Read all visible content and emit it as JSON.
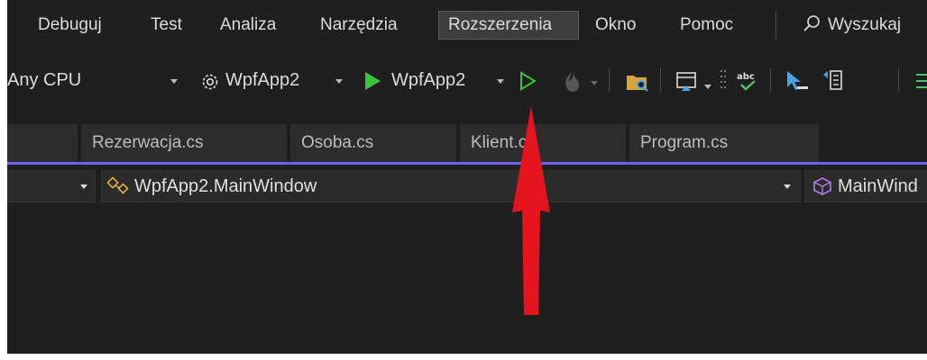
{
  "menu": {
    "items": [
      {
        "label": "Debuguj"
      },
      {
        "label": "Test"
      },
      {
        "label": "Analiza"
      },
      {
        "label": "Narzędzia"
      },
      {
        "label": "Rozszerzenia",
        "active": true
      },
      {
        "label": "Okno"
      },
      {
        "label": "Pomoc"
      }
    ],
    "search_label": "Wyszukaj"
  },
  "toolbar": {
    "platform_value": "Any CPU",
    "startup_project": "WpfApp2",
    "run_target": "WpfApp2",
    "icons": [
      "gear-icon",
      "start-debugging-icon",
      "start-without-debugging-icon",
      "hot-reload-icon",
      "solution-explorer-icon",
      "window-layout-icon",
      "spell-check-icon",
      "pointer-icon",
      "document-outline-icon"
    ]
  },
  "tabs": [
    {
      "label": ""
    },
    {
      "label": "Rezerwacja.cs"
    },
    {
      "label": "Osoba.cs"
    },
    {
      "label": "Klient.cs"
    },
    {
      "label": "Program.cs"
    }
  ],
  "navbar": {
    "type_value": "WpfApp2.MainWindow",
    "member_value": "MainWind"
  },
  "colors": {
    "background": "#1f1f1f",
    "accent": "#7160e8",
    "run_green": "#3bc43b",
    "annotation_red": "#e5141f"
  }
}
